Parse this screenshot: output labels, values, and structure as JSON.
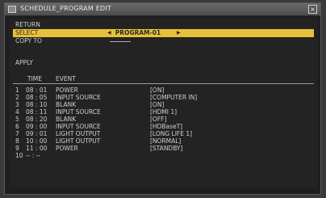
{
  "window": {
    "title": "SCHEDULE_PROGRAM EDIT",
    "close_symbol": "×"
  },
  "menu": {
    "return_label": "RETURN",
    "select_label": "SELECT",
    "select_value": "PROGRAM-01",
    "left_arrow": "◀",
    "right_arrow": "▶",
    "copy_to_label": "COPY TO",
    "apply_label": "APPLY"
  },
  "table": {
    "headers": {
      "time": "TIME",
      "event": "EVENT"
    },
    "rows": [
      {
        "num": "1",
        "time": "08 : 01",
        "event": "POWER",
        "param": "[ON]"
      },
      {
        "num": "2",
        "time": "08 : 05",
        "event": "INPUT SOURCE",
        "param": "[COMPUTER IN]"
      },
      {
        "num": "3",
        "time": "08 : 10",
        "event": "BLANK",
        "param": "[ON]"
      },
      {
        "num": "4",
        "time": "08 : 11",
        "event": "INPUT SOURCE",
        "param": "[HDMI 1]"
      },
      {
        "num": "5",
        "time": "08 : 20",
        "event": "BLANK",
        "param": "[OFF]"
      },
      {
        "num": "6",
        "time": "09 : 00",
        "event": "INPUT SOURCE",
        "param": "[HDBaseT]"
      },
      {
        "num": "7",
        "time": "09 : 01",
        "event": "LIGHT OUTPUT",
        "param": "[LONG LIFE 1]"
      },
      {
        "num": "8",
        "time": "10 : 00",
        "event": "LIGHT OUTPUT",
        "param": "[NORMAL]"
      },
      {
        "num": "9",
        "time": "11 : 00",
        "event": "POWER",
        "param": "[STANDBY]"
      },
      {
        "num": "10",
        "time": "-- : --",
        "event": "",
        "param": ""
      }
    ]
  },
  "colors": {
    "selection": "#e8c13a",
    "background": "#232323",
    "text": "#cfcfcf"
  }
}
